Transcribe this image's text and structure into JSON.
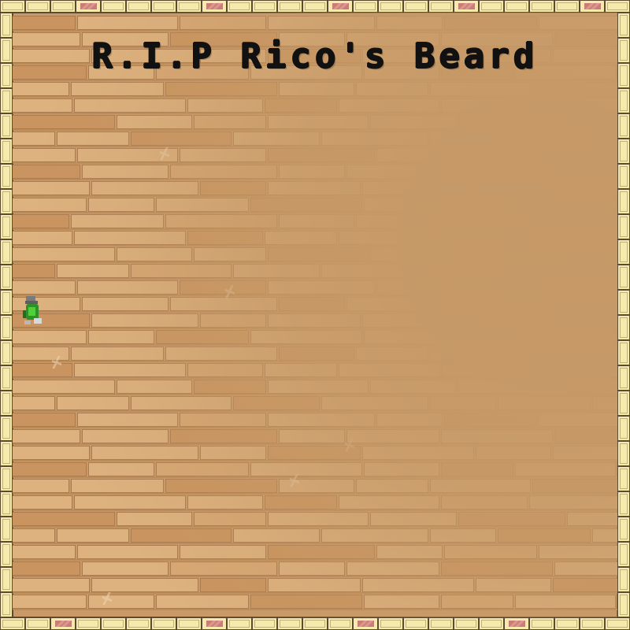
{
  "game": {
    "title": "R.I.P Rico's Beard"
  },
  "icons": {
    "player": "green-character-icon"
  },
  "colors": {
    "background": "#c99a67",
    "brick_light": "#ddb27f",
    "brick_dark": "#c9945f",
    "border_cream": "#f6ebad",
    "border_pink": "#c86f72",
    "title_text": "#111111"
  }
}
